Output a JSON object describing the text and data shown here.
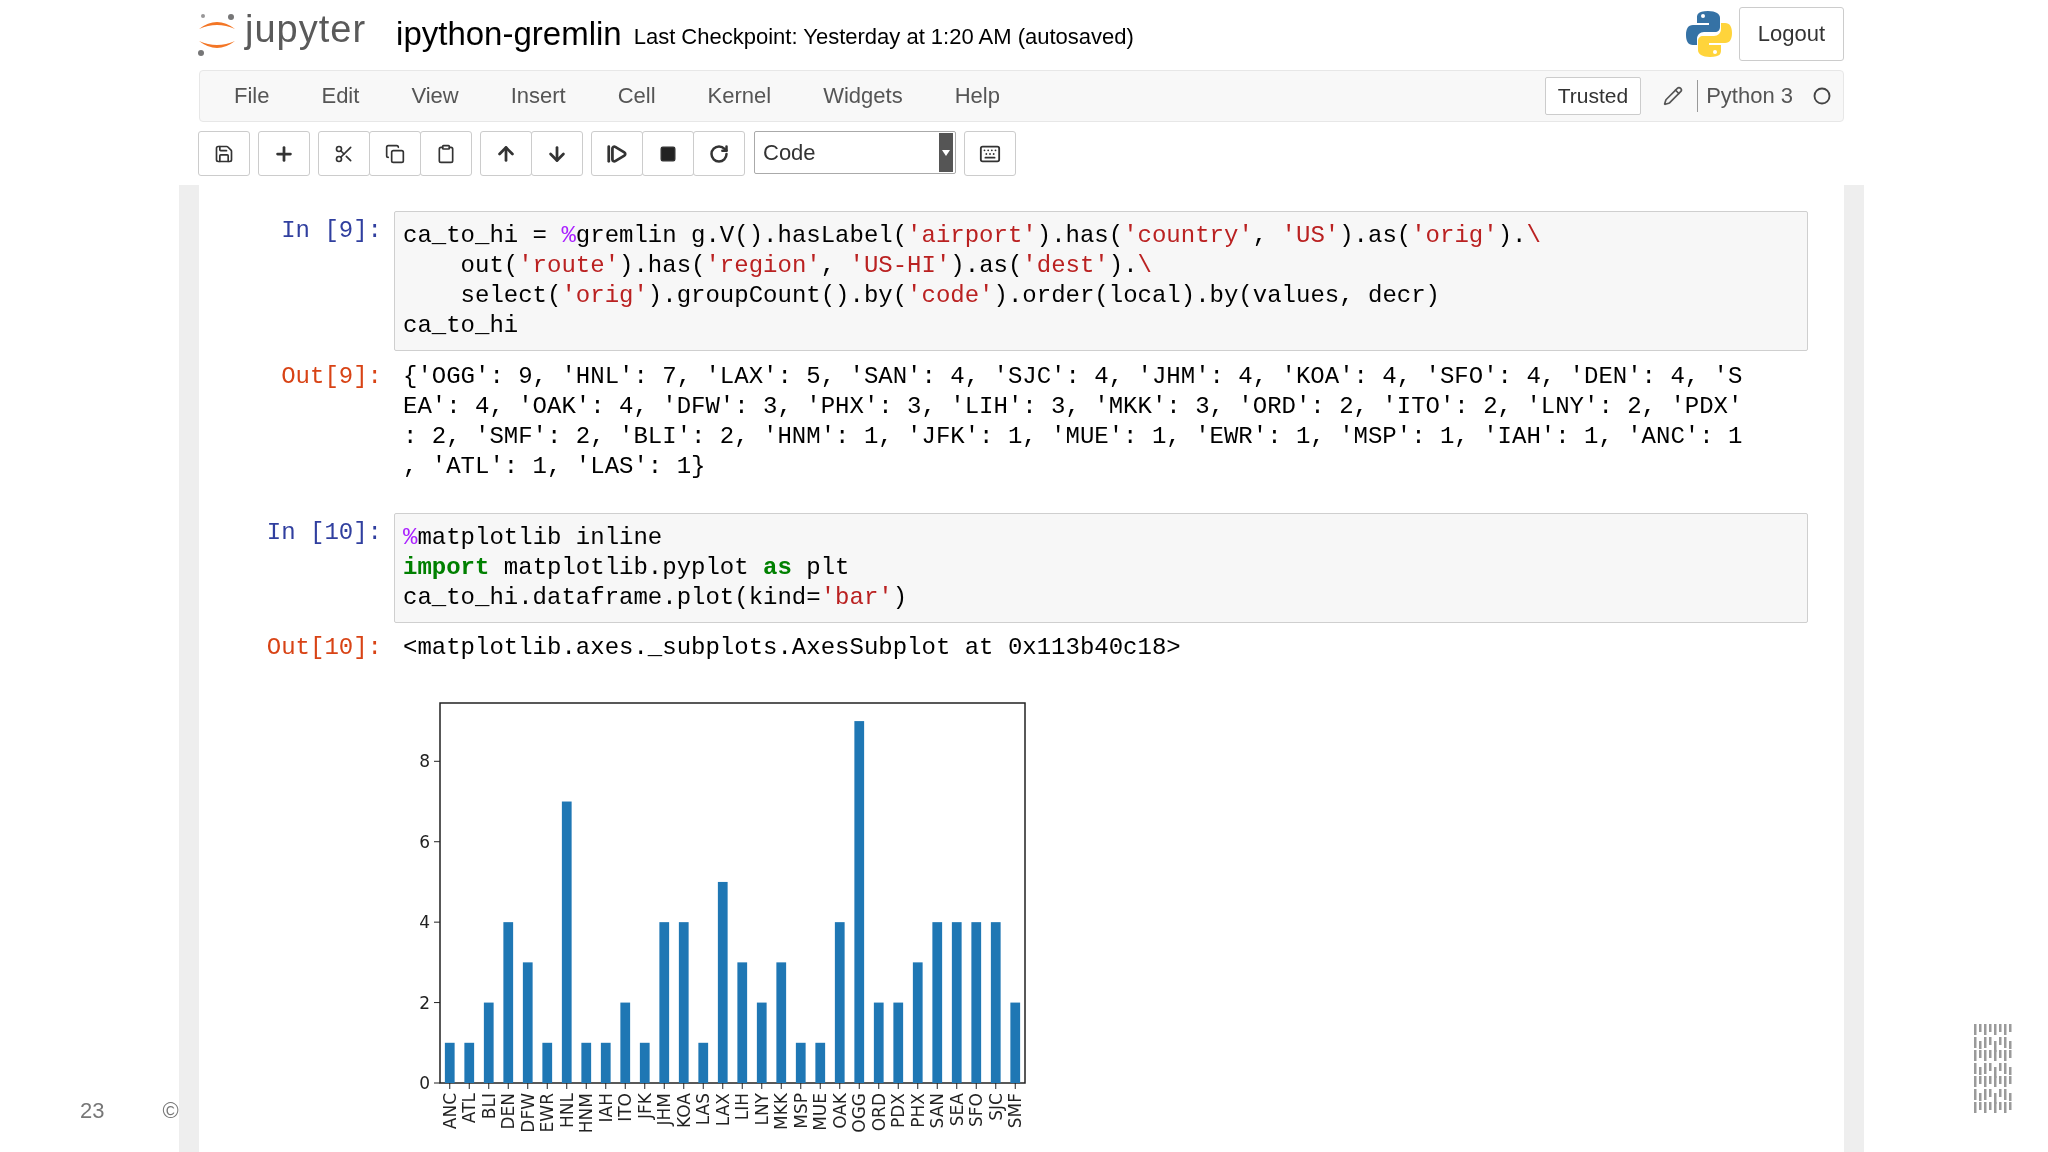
{
  "slide": {
    "page_number": "23",
    "copyright": "©"
  },
  "header": {
    "logo_text": "jupyter",
    "notebook_name": "ipython-gremlin",
    "checkpoint": "Last Checkpoint: Yesterday at 1:20 AM (autosaved)",
    "logout": "Logout"
  },
  "menu": {
    "items": [
      "File",
      "Edit",
      "View",
      "Insert",
      "Cell",
      "Kernel",
      "Widgets",
      "Help"
    ],
    "trusted": "Trusted",
    "kernel": "Python 3"
  },
  "toolbar": {
    "cell_type": "Code"
  },
  "cells": [
    {
      "kind": "input",
      "prompt": "In [9]:",
      "lines": [
        [
          {
            "text": "ca_to_hi = ",
            "kind": "plain"
          },
          {
            "text": "%",
            "kind": "magic"
          },
          {
            "text": "gremlin g.V().hasLabel(",
            "kind": "plain"
          },
          {
            "text": "'airport'",
            "kind": "string"
          },
          {
            "text": ").has(",
            "kind": "plain"
          },
          {
            "text": "'country'",
            "kind": "string"
          },
          {
            "text": ", ",
            "kind": "plain"
          },
          {
            "text": "'US'",
            "kind": "string"
          },
          {
            "text": ").as(",
            "kind": "plain"
          },
          {
            "text": "'orig'",
            "kind": "string"
          },
          {
            "text": ").",
            "kind": "plain"
          },
          {
            "text": "\\",
            "kind": "string"
          }
        ],
        [
          {
            "text": "    out(",
            "kind": "plain"
          },
          {
            "text": "'route'",
            "kind": "string"
          },
          {
            "text": ").has(",
            "kind": "plain"
          },
          {
            "text": "'region'",
            "kind": "string"
          },
          {
            "text": ", ",
            "kind": "plain"
          },
          {
            "text": "'US-HI'",
            "kind": "string"
          },
          {
            "text": ").as(",
            "kind": "plain"
          },
          {
            "text": "'dest'",
            "kind": "string"
          },
          {
            "text": ").",
            "kind": "plain"
          },
          {
            "text": "\\",
            "kind": "string"
          }
        ],
        [
          {
            "text": "    select(",
            "kind": "plain"
          },
          {
            "text": "'orig'",
            "kind": "string"
          },
          {
            "text": ").groupCount().by(",
            "kind": "plain"
          },
          {
            "text": "'code'",
            "kind": "string"
          },
          {
            "text": ").order(local).by(values, decr)",
            "kind": "plain"
          }
        ],
        [
          {
            "text": "ca_to_hi",
            "kind": "plain"
          }
        ]
      ]
    },
    {
      "kind": "output",
      "prompt": "Out[9]:",
      "lines": [
        "{'OGG': 9, 'HNL': 7, 'LAX': 5, 'SAN': 4, 'SJC': 4, 'JHM': 4, 'KOA': 4, 'SFO': 4, 'DEN': 4, 'S",
        "EA': 4, 'OAK': 4, 'DFW': 3, 'PHX': 3, 'LIH': 3, 'MKK': 3, 'ORD': 2, 'ITO': 2, 'LNY': 2, 'PDX'",
        ": 2, 'SMF': 2, 'BLI': 2, 'HNM': 1, 'JFK': 1, 'MUE': 1, 'EWR': 1, 'MSP': 1, 'IAH': 1, 'ANC': 1",
        ", 'ATL': 1, 'LAS': 1}"
      ]
    },
    {
      "kind": "input",
      "prompt": "In [10]:",
      "lines": [
        [
          {
            "text": "%",
            "kind": "magic"
          },
          {
            "text": "matplotlib inline",
            "kind": "plain"
          }
        ],
        [
          {
            "text": "import",
            "kind": "keyword"
          },
          {
            "text": " matplotlib.pyplot ",
            "kind": "plain"
          },
          {
            "text": "as",
            "kind": "keyword"
          },
          {
            "text": " plt",
            "kind": "plain"
          }
        ],
        [
          {
            "text": "ca_to_hi.dataframe.plot(kind=",
            "kind": "plain"
          },
          {
            "text": "'bar'",
            "kind": "string"
          },
          {
            "text": ")",
            "kind": "plain"
          }
        ]
      ]
    },
    {
      "kind": "output",
      "prompt": "Out[10]:",
      "lines": [
        "<matplotlib.axes._subplots.AxesSubplot at 0x113b40c18>"
      ]
    },
    {
      "kind": "chart",
      "chart_data": {
        "type": "bar",
        "categories": [
          "ANC",
          "ATL",
          "BLI",
          "DEN",
          "DFW",
          "EWR",
          "HNL",
          "HNM",
          "IAH",
          "ITO",
          "JFK",
          "JHM",
          "KOA",
          "LAS",
          "LAX",
          "LIH",
          "LNY",
          "MKK",
          "MSP",
          "MUE",
          "OAK",
          "OGG",
          "ORD",
          "PDX",
          "PHX",
          "SAN",
          "SEA",
          "SFO",
          "SJC",
          "SMF"
        ],
        "values": [
          1,
          1,
          2,
          4,
          3,
          1,
          7,
          1,
          1,
          2,
          1,
          4,
          4,
          1,
          5,
          3,
          2,
          3,
          1,
          1,
          4,
          9,
          2,
          2,
          3,
          4,
          4,
          4,
          4,
          2
        ],
        "ylim": [
          0,
          9.45
        ],
        "yticks": [
          0,
          2,
          4,
          6,
          8
        ]
      }
    }
  ]
}
